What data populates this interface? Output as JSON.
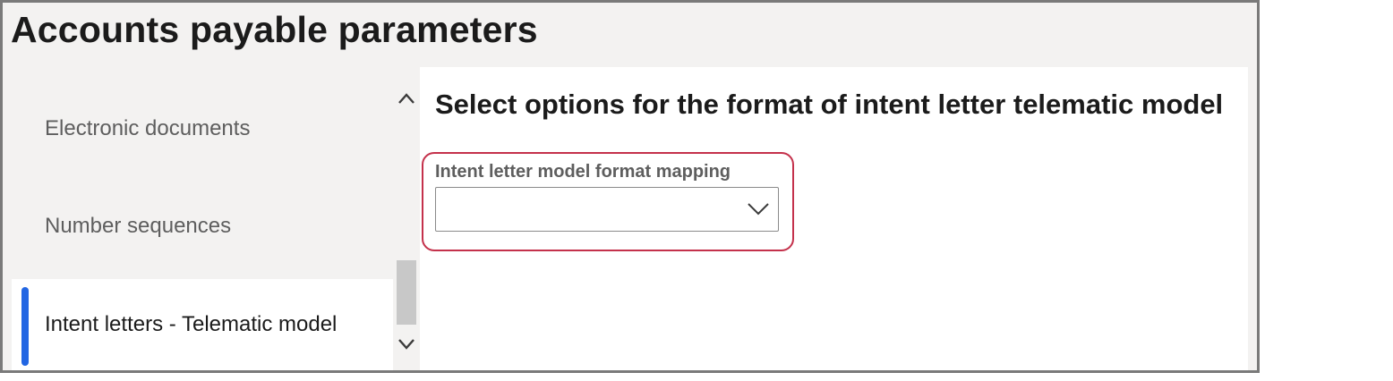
{
  "page": {
    "title": "Accounts payable parameters"
  },
  "nav": {
    "items": [
      {
        "label": "Electronic documents",
        "selected": false
      },
      {
        "label": "Number sequences",
        "selected": false
      },
      {
        "label": "Intent letters - Telematic model",
        "selected": true
      }
    ],
    "selected_indicator_color": "#2266e3"
  },
  "scrollbar": {
    "up_icon": "chevron-up-icon",
    "down_icon": "chevron-down-icon"
  },
  "content": {
    "section_title": "Select options for the format of intent letter telematic model",
    "field": {
      "label": "Intent letter model format mapping",
      "value": "",
      "icon": "chevron-down-icon"
    },
    "highlight_color": "#c4314b"
  }
}
